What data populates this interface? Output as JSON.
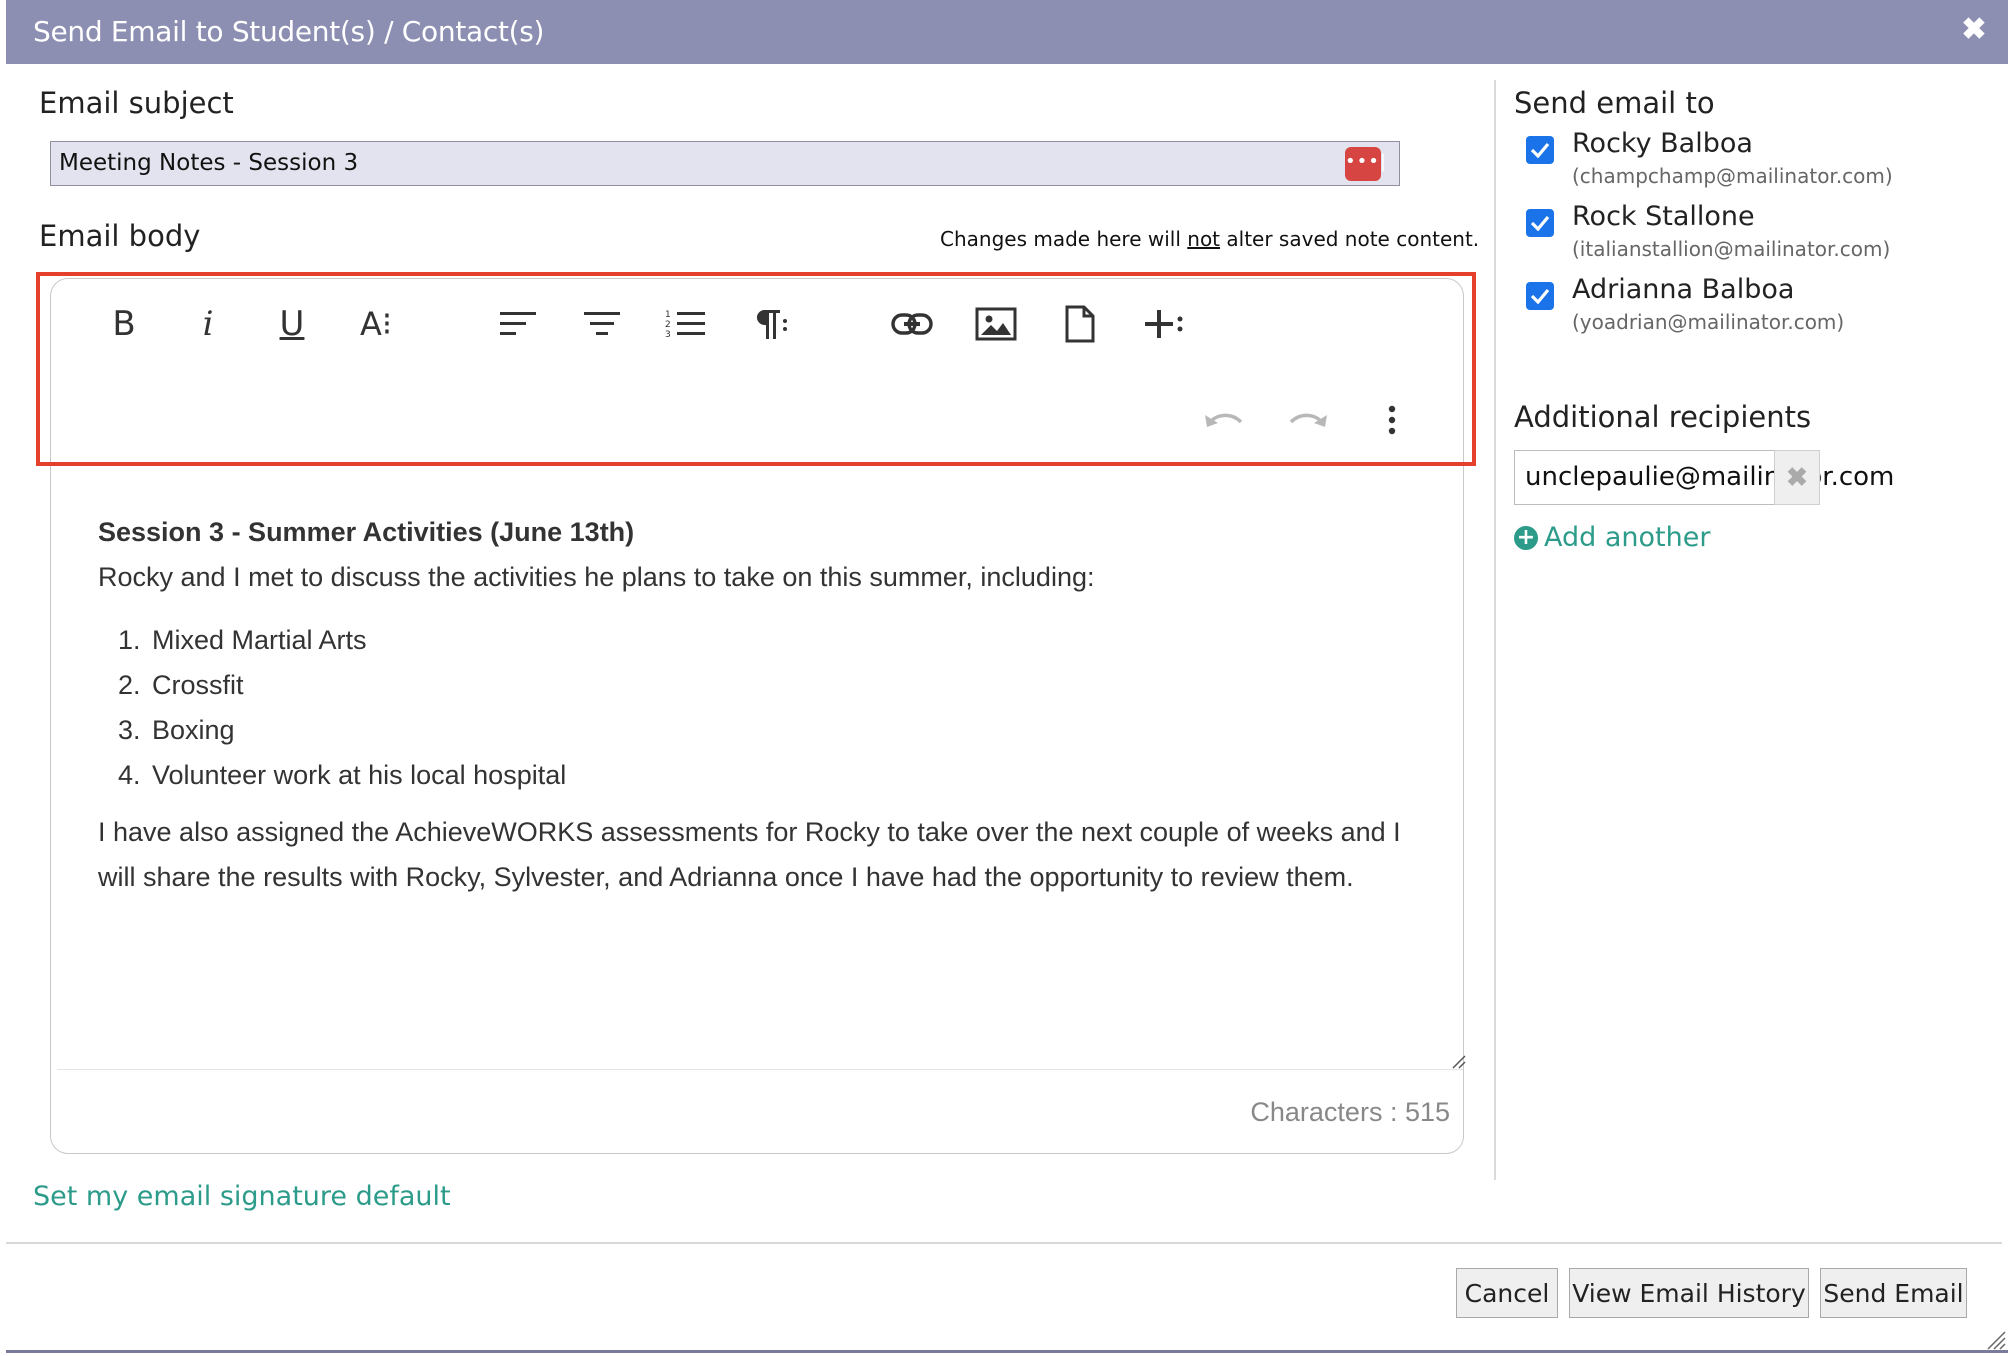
{
  "dialog": {
    "title": "Send Email to Student(s) / Contact(s)",
    "close_label": "✖"
  },
  "subject": {
    "label": "Email subject",
    "value": "Meeting Notes - Session 3",
    "password_icon_label": "•••|"
  },
  "body": {
    "label": "Email body",
    "note_prefix": "Changes made here will ",
    "note_emphasis": "not",
    "note_suffix": " alter saved note content.",
    "toolbar": {
      "bold": "B",
      "italic": "i",
      "underline": "U",
      "font_size": "A⁝"
    },
    "content": {
      "heading": "Session 3 - Summer Activities (June 13th)",
      "intro": "Rocky and I met to discuss the activities he plans to take on this summer, including:",
      "list": [
        "Mixed Martial Arts",
        "Crossfit",
        "Boxing",
        "Volunteer work at his local hospital"
      ],
      "closing": "I have also assigned the AchieveWORKS assessments for Rocky to take over the next couple of weeks and I will share the results with Rocky, Sylvester, and Adrianna once I have had the opportunity to review them."
    },
    "char_count": "Characters : 515"
  },
  "signature_link": "Set my email signature default",
  "send_to": {
    "label": "Send email to",
    "recipients": [
      {
        "name": "Rocky Balboa",
        "email": "(champchamp@mailinator.com)",
        "checked": true
      },
      {
        "name": "Rock Stallone",
        "email": "(italianstallion@mailinator.com)",
        "checked": true
      },
      {
        "name": "Adrianna Balboa",
        "email": "(yoadrian@mailinator.com)",
        "checked": true
      }
    ]
  },
  "additional": {
    "label": "Additional recipients",
    "value": "unclepaulie@mailinator.com",
    "clear_label": "✖",
    "add_another": "Add another"
  },
  "footer": {
    "cancel": "Cancel",
    "history": "View Email History",
    "send": "Send Email"
  },
  "colors": {
    "titlebar": "#8c8fb2",
    "accent_link": "#2c9b8a",
    "highlight": "#e4402e",
    "checkbox": "#1a73e8"
  }
}
